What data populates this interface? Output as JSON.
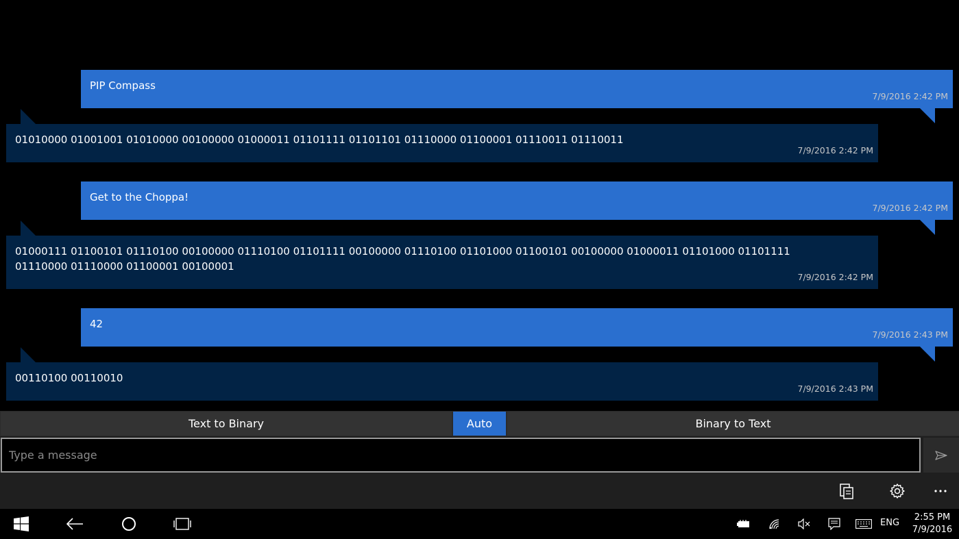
{
  "messages": [
    {
      "type": "sent",
      "text": "PIP Compass",
      "time": "7/9/2016 2:42 PM"
    },
    {
      "type": "recv",
      "text": "01010000 01001001 01010000 00100000 01000011 01101111 01101101 01110000 01100001 01110011 01110011",
      "time": "7/9/2016 2:42 PM"
    },
    {
      "type": "sent",
      "text": "Get to the Choppa!",
      "time": "7/9/2016 2:42 PM"
    },
    {
      "type": "recv",
      "text": "01000111 01100101 01110100 00100000 01110100 01101111 00100000 01110100 01101000 01100101 00100000 01000011 01101000 01101111 01110000 01110000 01100001 00100001",
      "time": "7/9/2016 2:42 PM"
    },
    {
      "type": "sent",
      "text": "42",
      "time": "7/9/2016 2:43 PM"
    },
    {
      "type": "recv",
      "text": "00110100 00110010",
      "time": "7/9/2016 2:43 PM"
    }
  ],
  "modes": {
    "text_to_binary": "Text to Binary",
    "auto": "Auto",
    "binary_to_text": "Binary to Text",
    "active": "auto"
  },
  "input": {
    "placeholder": "Type a message",
    "value": ""
  },
  "icons": {
    "send": "send-icon",
    "paste": "paste-icon",
    "settings": "gear-icon",
    "more": "more-icon"
  },
  "taskbar": {
    "language": "ENG",
    "time": "2:55 PM",
    "date": "7/9/2016"
  },
  "colors": {
    "sent_bubble": "#2a6fcf",
    "recv_bubble": "#022345",
    "accent": "#2a6fcf"
  }
}
